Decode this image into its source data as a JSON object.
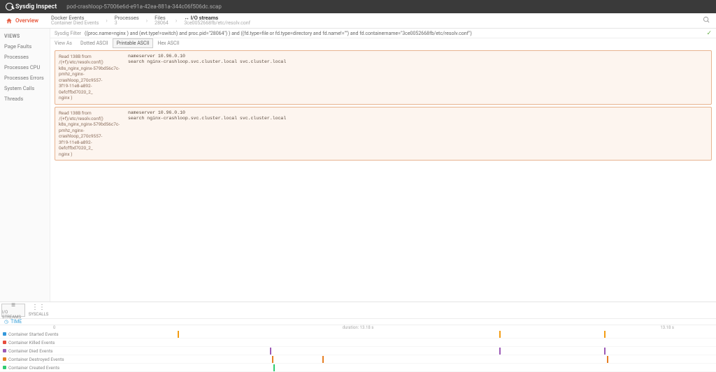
{
  "app": {
    "name": "Sysdig Inspect",
    "file": "pod-crashloop-57006e6d-e91a-42ea-881a-344c06f506dc.scap"
  },
  "nav": {
    "overview": "Overview"
  },
  "breadcrumbs": [
    {
      "title": "Docker Events",
      "sub": "Container Died Events"
    },
    {
      "title": "Processes",
      "sub": "3"
    },
    {
      "title": "Files",
      "sub": "28064"
    },
    {
      "title": "I/O streams",
      "sub": "3ce0052668fb/etc/resolv.conf",
      "current": true,
      "icon": "↔"
    }
  ],
  "sidebar": {
    "header": "VIEWS",
    "items": [
      "Page Faults",
      "Processes",
      "Processes CPU",
      "Processes Errors",
      "System Calls",
      "Threads"
    ]
  },
  "filter": {
    "label": "Sysdig Filter",
    "expr": "((proc.name=nginx ) and (evt.type!=switch) and proc.pid=\"28064\") ) and ((fd.type=file or fd.type=directory and fd.name!=\"\") and fd.containername=\"3ce0052668fb/etc/resolv.conf\")"
  },
  "viewas": {
    "label": "View As",
    "tabs": [
      "Dotted ASCII",
      "Printable ASCII",
      "Hex ASCII"
    ],
    "active": 1
  },
  "blocks": [
    {
      "head": "Read 138B from\n/(+f)/etc/resolv.conf()\nk8s_nginx_nginx-579bd56c7c-\npmhz_nginx-crashloop_270c9557-\n3f19-11e8-a892-0efcffbd7020_2_\nnginx )",
      "body": "nameserver 10.96.0.10\nsearch nginx-crashloop.svc.cluster.local svc.cluster.local"
    },
    {
      "head": "Read 138B from\n/(+f)/etc/resolv.conf()\nk8s_nginx_nginx-579bd56c7c-\npmhz_nginx-crashloop_270c9557-\n3f19-11e8-a892-0efcffbd7020_2_\nnginx )",
      "body": "nameserver 10.96.0.10\nsearch nginx-crashloop.svc.cluster.local svc.cluster.local"
    }
  ],
  "footer": {
    "tabs": [
      {
        "icon": "≡",
        "label": "I/O STREAMS"
      },
      {
        "icon": "⋮⋮",
        "label": "SYSCALLS"
      }
    ],
    "active": 0,
    "time_label": "TIME",
    "start": "0",
    "dur": "duration: 13.18 s",
    "end": "13.18 s",
    "lanes": [
      {
        "name": "Container Started Events",
        "color": "#3498db",
        "marks": [
          {
            "x": 19,
            "c": "#f39c12"
          },
          {
            "x": 68,
            "c": "#f39c12"
          },
          {
            "x": 84,
            "c": "#f39c12"
          }
        ]
      },
      {
        "name": "Container Killed Events",
        "color": "#e74c3c",
        "marks": []
      },
      {
        "name": "Container Died Events",
        "color": "#9b59b6",
        "marks": [
          {
            "x": 33,
            "c": "#9b59b6"
          },
          {
            "x": 68,
            "c": "#9b59b6"
          },
          {
            "x": 84,
            "c": "#9b59b6"
          }
        ]
      },
      {
        "name": "Container Destroyed Events",
        "color": "#e67e22",
        "marks": [
          {
            "x": 33.4,
            "c": "#e67e22"
          },
          {
            "x": 41,
            "c": "#e67e22"
          },
          {
            "x": 84.4,
            "c": "#e67e22"
          }
        ]
      },
      {
        "name": "Container Created Events",
        "color": "#2ecc71",
        "marks": [
          {
            "x": 33.6,
            "c": "#2ecc71"
          }
        ]
      }
    ]
  }
}
